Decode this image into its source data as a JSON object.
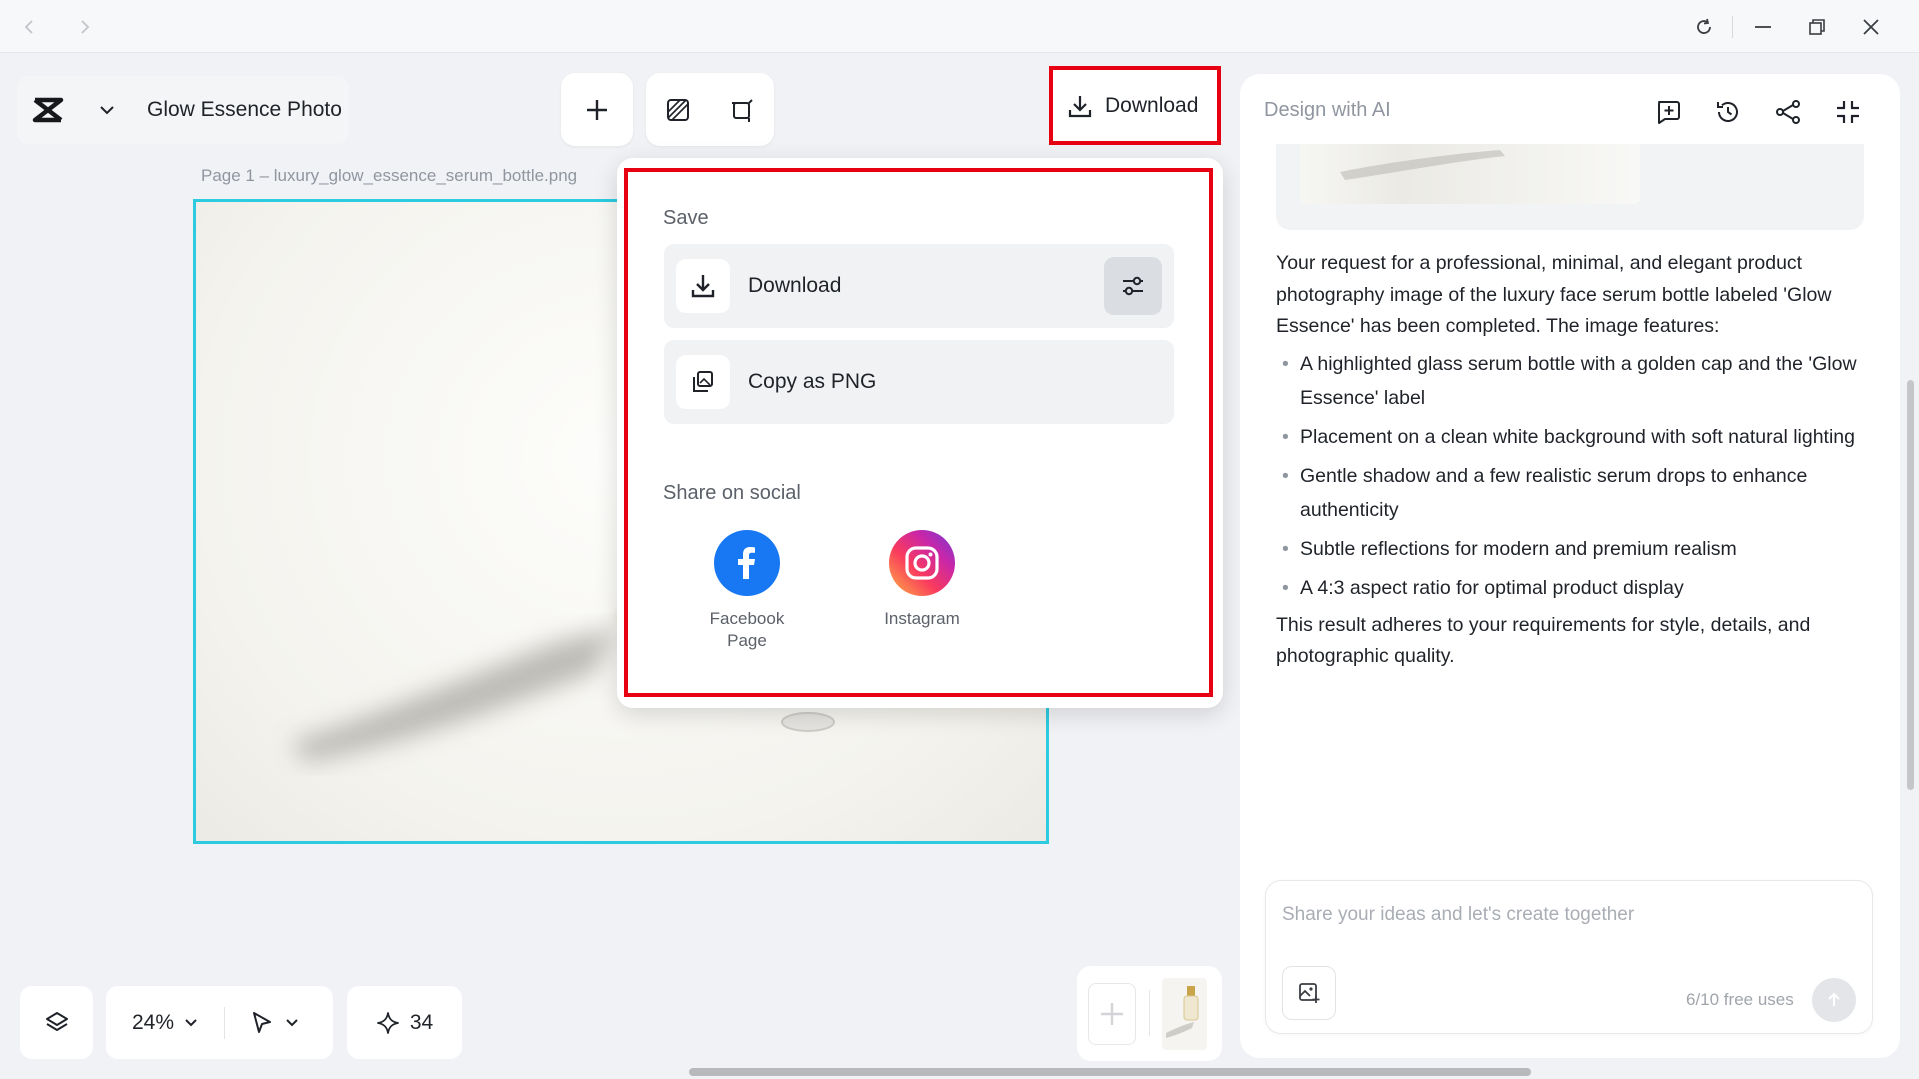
{
  "titlebar": {
    "back": "back-arrow-icon",
    "forward": "forward-arrow-icon",
    "refresh": "refresh-icon",
    "minimize": "minimize-icon",
    "restore": "restore-icon",
    "close": "close-icon"
  },
  "project": {
    "title": "Glow Essence Photo"
  },
  "toolbar": {
    "download_label": "Download"
  },
  "canvas": {
    "page_label": "Page 1 –   luxury_glow_essence_serum_bottle.png",
    "accent": "#2ccbdf"
  },
  "popup": {
    "save_title": "Save",
    "download_label": "Download",
    "copy_label": "Copy as PNG",
    "share_title": "Share on social",
    "facebook_label_1": "Facebook",
    "facebook_label_2": "Page",
    "instagram_label": "Instagram",
    "highlight_color": "#e60012"
  },
  "right_panel": {
    "title": "Design with AI",
    "intro": "Your request for a professional, minimal, and elegant product photography image of the luxury face serum bottle labeled 'Glow Essence' has been completed. The image features:",
    "bullets": [
      "A highlighted glass serum bottle with a golden cap and the 'Glow Essence' label",
      "Placement on a clean white background with soft natural lighting",
      "Gentle shadow and a few realistic serum drops to enhance authenticity",
      "Subtle reflections for modern and premium realism",
      "A 4:3 aspect ratio for optimal product display"
    ],
    "outro": "This result adheres to your requirements for style, details, and photographic quality.",
    "chat_placeholder": "Share your ideas and let's create together",
    "free_uses": "6/10 free uses"
  },
  "bottom": {
    "zoom": "24%",
    "credits": "34"
  }
}
